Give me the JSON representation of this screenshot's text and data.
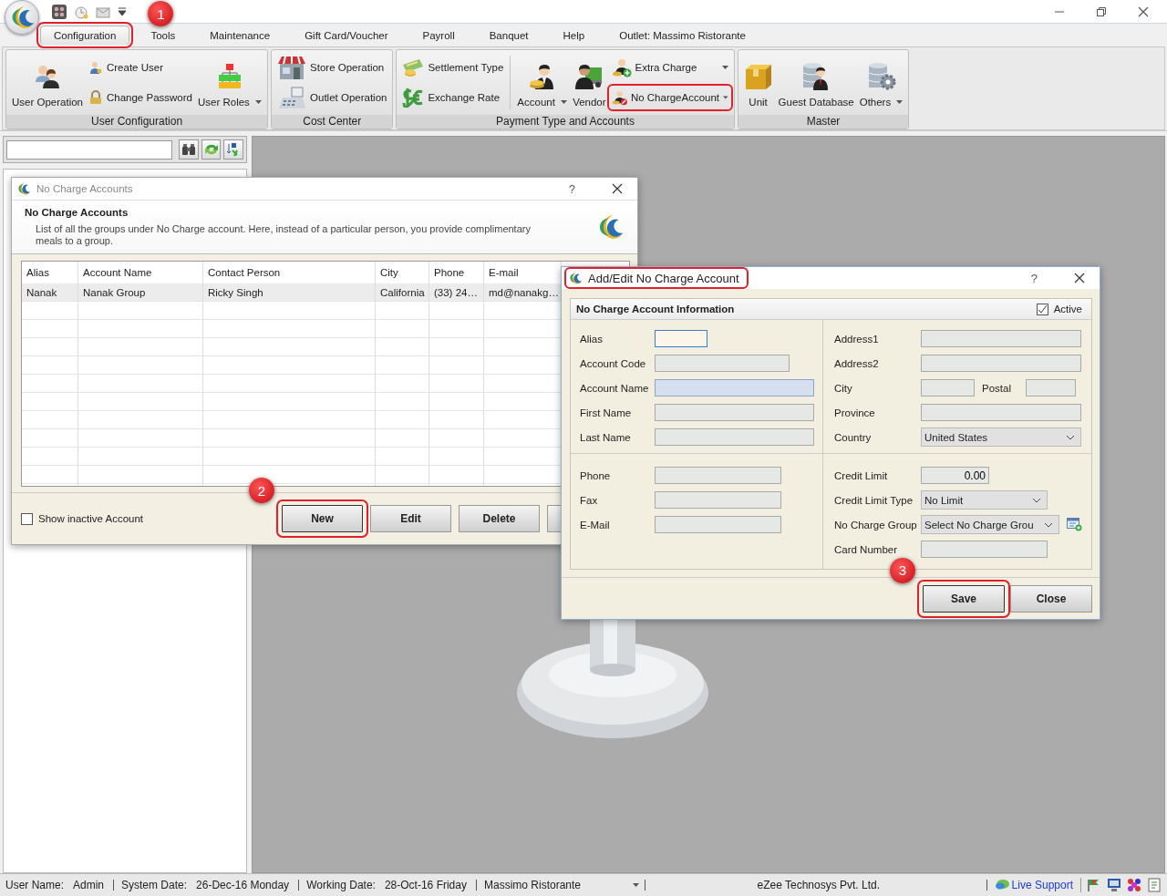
{
  "tabs": [
    {
      "label": "Configuration",
      "selected": true,
      "highlighted": true,
      "callout": "1"
    },
    {
      "label": "Tools",
      "selected": false,
      "highlighted": false
    },
    {
      "label": "Maintenance",
      "selected": false,
      "highlighted": false
    },
    {
      "label": "Gift Card/Voucher",
      "selected": false,
      "highlighted": false
    },
    {
      "label": "Payroll",
      "selected": false,
      "highlighted": false
    },
    {
      "label": "Banquet",
      "selected": false,
      "highlighted": false
    },
    {
      "label": "Help",
      "selected": false,
      "highlighted": false
    },
    {
      "label": "Outlet: Massimo Ristorante",
      "selected": false,
      "highlighted": false
    }
  ],
  "ribbon": {
    "groups": [
      {
        "title": "User Configuration",
        "columns": [
          [
            {
              "label": "User Operation",
              "dropdown": false,
              "highlighted": false
            }
          ],
          [
            {
              "label": "Create User",
              "dropdown": false,
              "highlighted": false
            },
            {
              "label": "Change Password",
              "dropdown": false,
              "highlighted": false
            }
          ],
          [
            {
              "label": "User Roles",
              "dropdown": true,
              "highlighted": false
            }
          ]
        ]
      },
      {
        "title": "Cost Center",
        "columns": [
          [
            {
              "label": "Store Operation",
              "dropdown": false,
              "highlighted": false
            },
            {
              "label": "Outlet Operation",
              "dropdown": false,
              "highlighted": false
            }
          ]
        ]
      },
      {
        "title": "Payment Type and Accounts",
        "columns": [
          [
            {
              "label": "Settlement Type",
              "dropdown": false,
              "highlighted": false
            },
            {
              "label": "Exchange Rate",
              "dropdown": false,
              "highlighted": false
            }
          ],
          [
            {
              "label": "Account",
              "dropdown": true,
              "highlighted": false
            }
          ],
          [
            {
              "label": "Vendor",
              "dropdown": false,
              "highlighted": false
            }
          ],
          [
            {
              "label": "Extra Charge",
              "dropdown": true,
              "highlighted": false
            },
            {
              "label": "No ChargeAccount",
              "dropdown": true,
              "highlighted": true
            }
          ]
        ]
      },
      {
        "title": "Master",
        "columns": [
          [
            {
              "label": "Unit",
              "dropdown": false,
              "highlighted": false
            }
          ],
          [
            {
              "label": "Guest Database",
              "dropdown": false,
              "highlighted": false
            }
          ],
          [
            {
              "label": "Others",
              "dropdown": true,
              "highlighted": false
            }
          ]
        ]
      }
    ]
  },
  "list_dialog": {
    "title": "No Charge Accounts",
    "help": "?",
    "heading": "No Charge Accounts",
    "description": "List of all the groups under No Charge account. Here, instead of a particular person, you provide complimentary meals to a group.",
    "table": {
      "columns": [
        "Alias",
        "Account Name",
        "Contact Person",
        "City",
        "Phone",
        "E-mail"
      ],
      "rows": [
        [
          "Nanak",
          "Nanak Group",
          "Ricky  Singh",
          "California",
          "(33) 24…",
          "md@nanakg…"
        ]
      ]
    },
    "show_inactive": {
      "label": "Show inactive Account",
      "checked": false
    },
    "buttons": [
      {
        "label": "New",
        "highlighted": true,
        "callout": "2"
      },
      {
        "label": "Edit",
        "highlighted": false
      },
      {
        "label": "Delete",
        "highlighted": false
      }
    ]
  },
  "edit_dialog": {
    "title": "Add/Edit No Charge Account",
    "title_highlighted": true,
    "help": "?",
    "section_title": "No Charge Account Information",
    "active": {
      "label": "Active",
      "checked": true
    },
    "blocks": [
      {
        "left": [
          {
            "label": "Alias",
            "kind": "text",
            "focused": true,
            "required": false
          },
          {
            "label": "Account Code",
            "kind": "text",
            "focused": false,
            "required": false
          },
          {
            "label": "Account Name",
            "kind": "text",
            "focused": false,
            "required": true
          },
          {
            "label": "First Name",
            "kind": "text",
            "focused": false,
            "required": false
          },
          {
            "label": "Last Name",
            "kind": "text",
            "focused": false,
            "required": false
          }
        ],
        "right": [
          {
            "label": "Address1",
            "kind": "text",
            "focused": false,
            "required": false
          },
          {
            "label": "Address2",
            "kind": "text",
            "focused": false,
            "required": false
          },
          {
            "label": "City",
            "kind": "text",
            "focused": false,
            "required": false,
            "extra_label": "Postal"
          },
          {
            "label": "Province",
            "kind": "text",
            "focused": false,
            "required": false
          },
          {
            "label": "Country",
            "kind": "select",
            "value": "United States"
          }
        ]
      },
      {
        "left": [
          {
            "label": "Phone",
            "kind": "text",
            "focused": false,
            "required": false
          },
          {
            "label": "Fax",
            "kind": "text",
            "focused": false,
            "required": false
          },
          {
            "label": "E-Mail",
            "kind": "text",
            "focused": false,
            "required": false
          }
        ],
        "right": [
          {
            "label": "Credit Limit",
            "kind": "number",
            "value": "0.00"
          },
          {
            "label": "Credit Limit Type",
            "kind": "select",
            "value": "No Limit"
          },
          {
            "label": "No Charge Group",
            "kind": "select",
            "value": "Select No Charge Grou",
            "add_button": true
          },
          {
            "label": "Card Number",
            "kind": "text",
            "focused": false,
            "required": false
          }
        ]
      }
    ],
    "buttons": [
      {
        "label": "Save",
        "highlighted": true,
        "callout": "3"
      },
      {
        "label": "Close",
        "highlighted": false
      }
    ]
  },
  "status_bar": {
    "user_label": "User Name:",
    "user": "Admin",
    "system_date_label": "System Date:",
    "system_date": "26-Dec-16 Monday",
    "working_date_label": "Working Date:",
    "working_date": "28-Oct-16 Friday",
    "outlet": "Massimo Ristorante",
    "company": "eZee Technosys Pvt. Ltd.",
    "support_link": "Live Support"
  }
}
